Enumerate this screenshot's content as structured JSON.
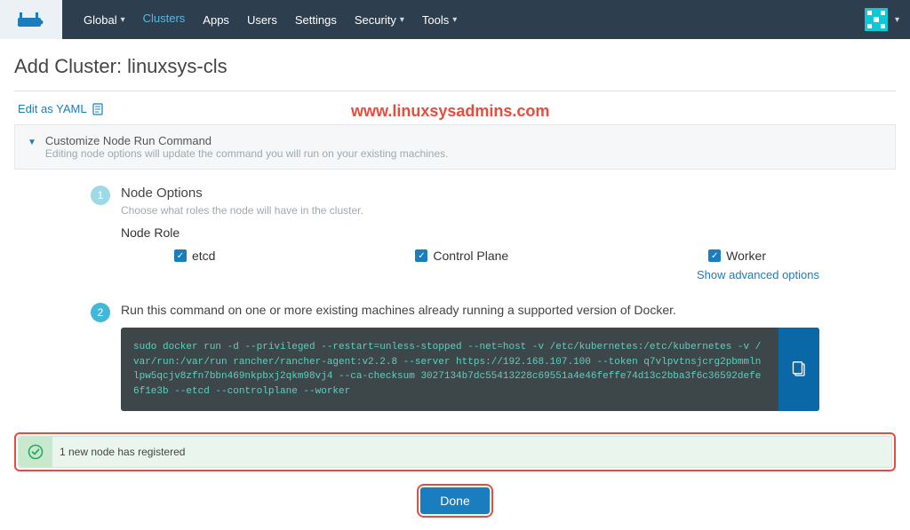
{
  "nav": {
    "scope_label": "Global",
    "items": [
      "Clusters",
      "Apps",
      "Users",
      "Settings",
      "Security",
      "Tools"
    ],
    "active_index": 0
  },
  "page": {
    "title": "Add Cluster: linuxsys-cls",
    "edit_yaml": "Edit as YAML",
    "watermark": "www.linuxsysadmins.com"
  },
  "accordion": {
    "title": "Customize Node Run Command",
    "subtitle": "Editing node options will update the command you will run on your existing machines."
  },
  "step1": {
    "title": "Node Options",
    "subtitle": "Choose what roles the node will have in the cluster.",
    "role_label": "Node Role",
    "roles": [
      "etcd",
      "Control Plane",
      "Worker"
    ],
    "advanced": "Show advanced options"
  },
  "step2": {
    "instruction": "Run this command on one or more existing machines already running a supported version of Docker.",
    "command": "sudo docker run -d --privileged --restart=unless-stopped --net=host -v /etc/kubernetes:/etc/kubernetes -v /var/run:/var/run rancher/rancher-agent:v2.2.8 --server https://192.168.107.100 --token q7vlpvtnsjcrg2pbmmlnlpw5qcjv8zfn7bbn469nkpbxj2qkm98vj4 --ca-checksum 3027134b7dc55413228c69551a4e46feffe74d13c2bba3f6c36592defe6f1e3b --etcd --controlplane --worker"
  },
  "banner": {
    "text": "1 new node has registered"
  },
  "footer": {
    "done_label": "Done"
  }
}
